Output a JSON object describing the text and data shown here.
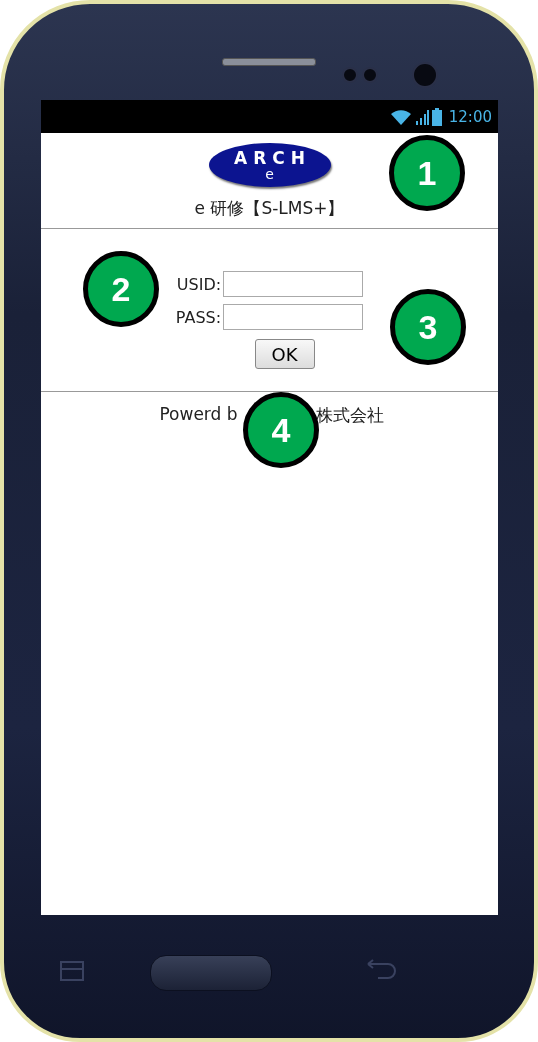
{
  "status_bar": {
    "time": "12:00"
  },
  "logo": {
    "top": "ARCH",
    "bottom": "e"
  },
  "title": "e 研修【S-LMS+】",
  "form": {
    "fields": [
      {
        "label": "USID:"
      },
      {
        "label": "PASS:"
      }
    ],
    "submit": "OK"
  },
  "footer": {
    "parts": [
      "Powerd b",
      "株式会社"
    ]
  },
  "callouts": [
    "1",
    "2",
    "3",
    "4"
  ]
}
